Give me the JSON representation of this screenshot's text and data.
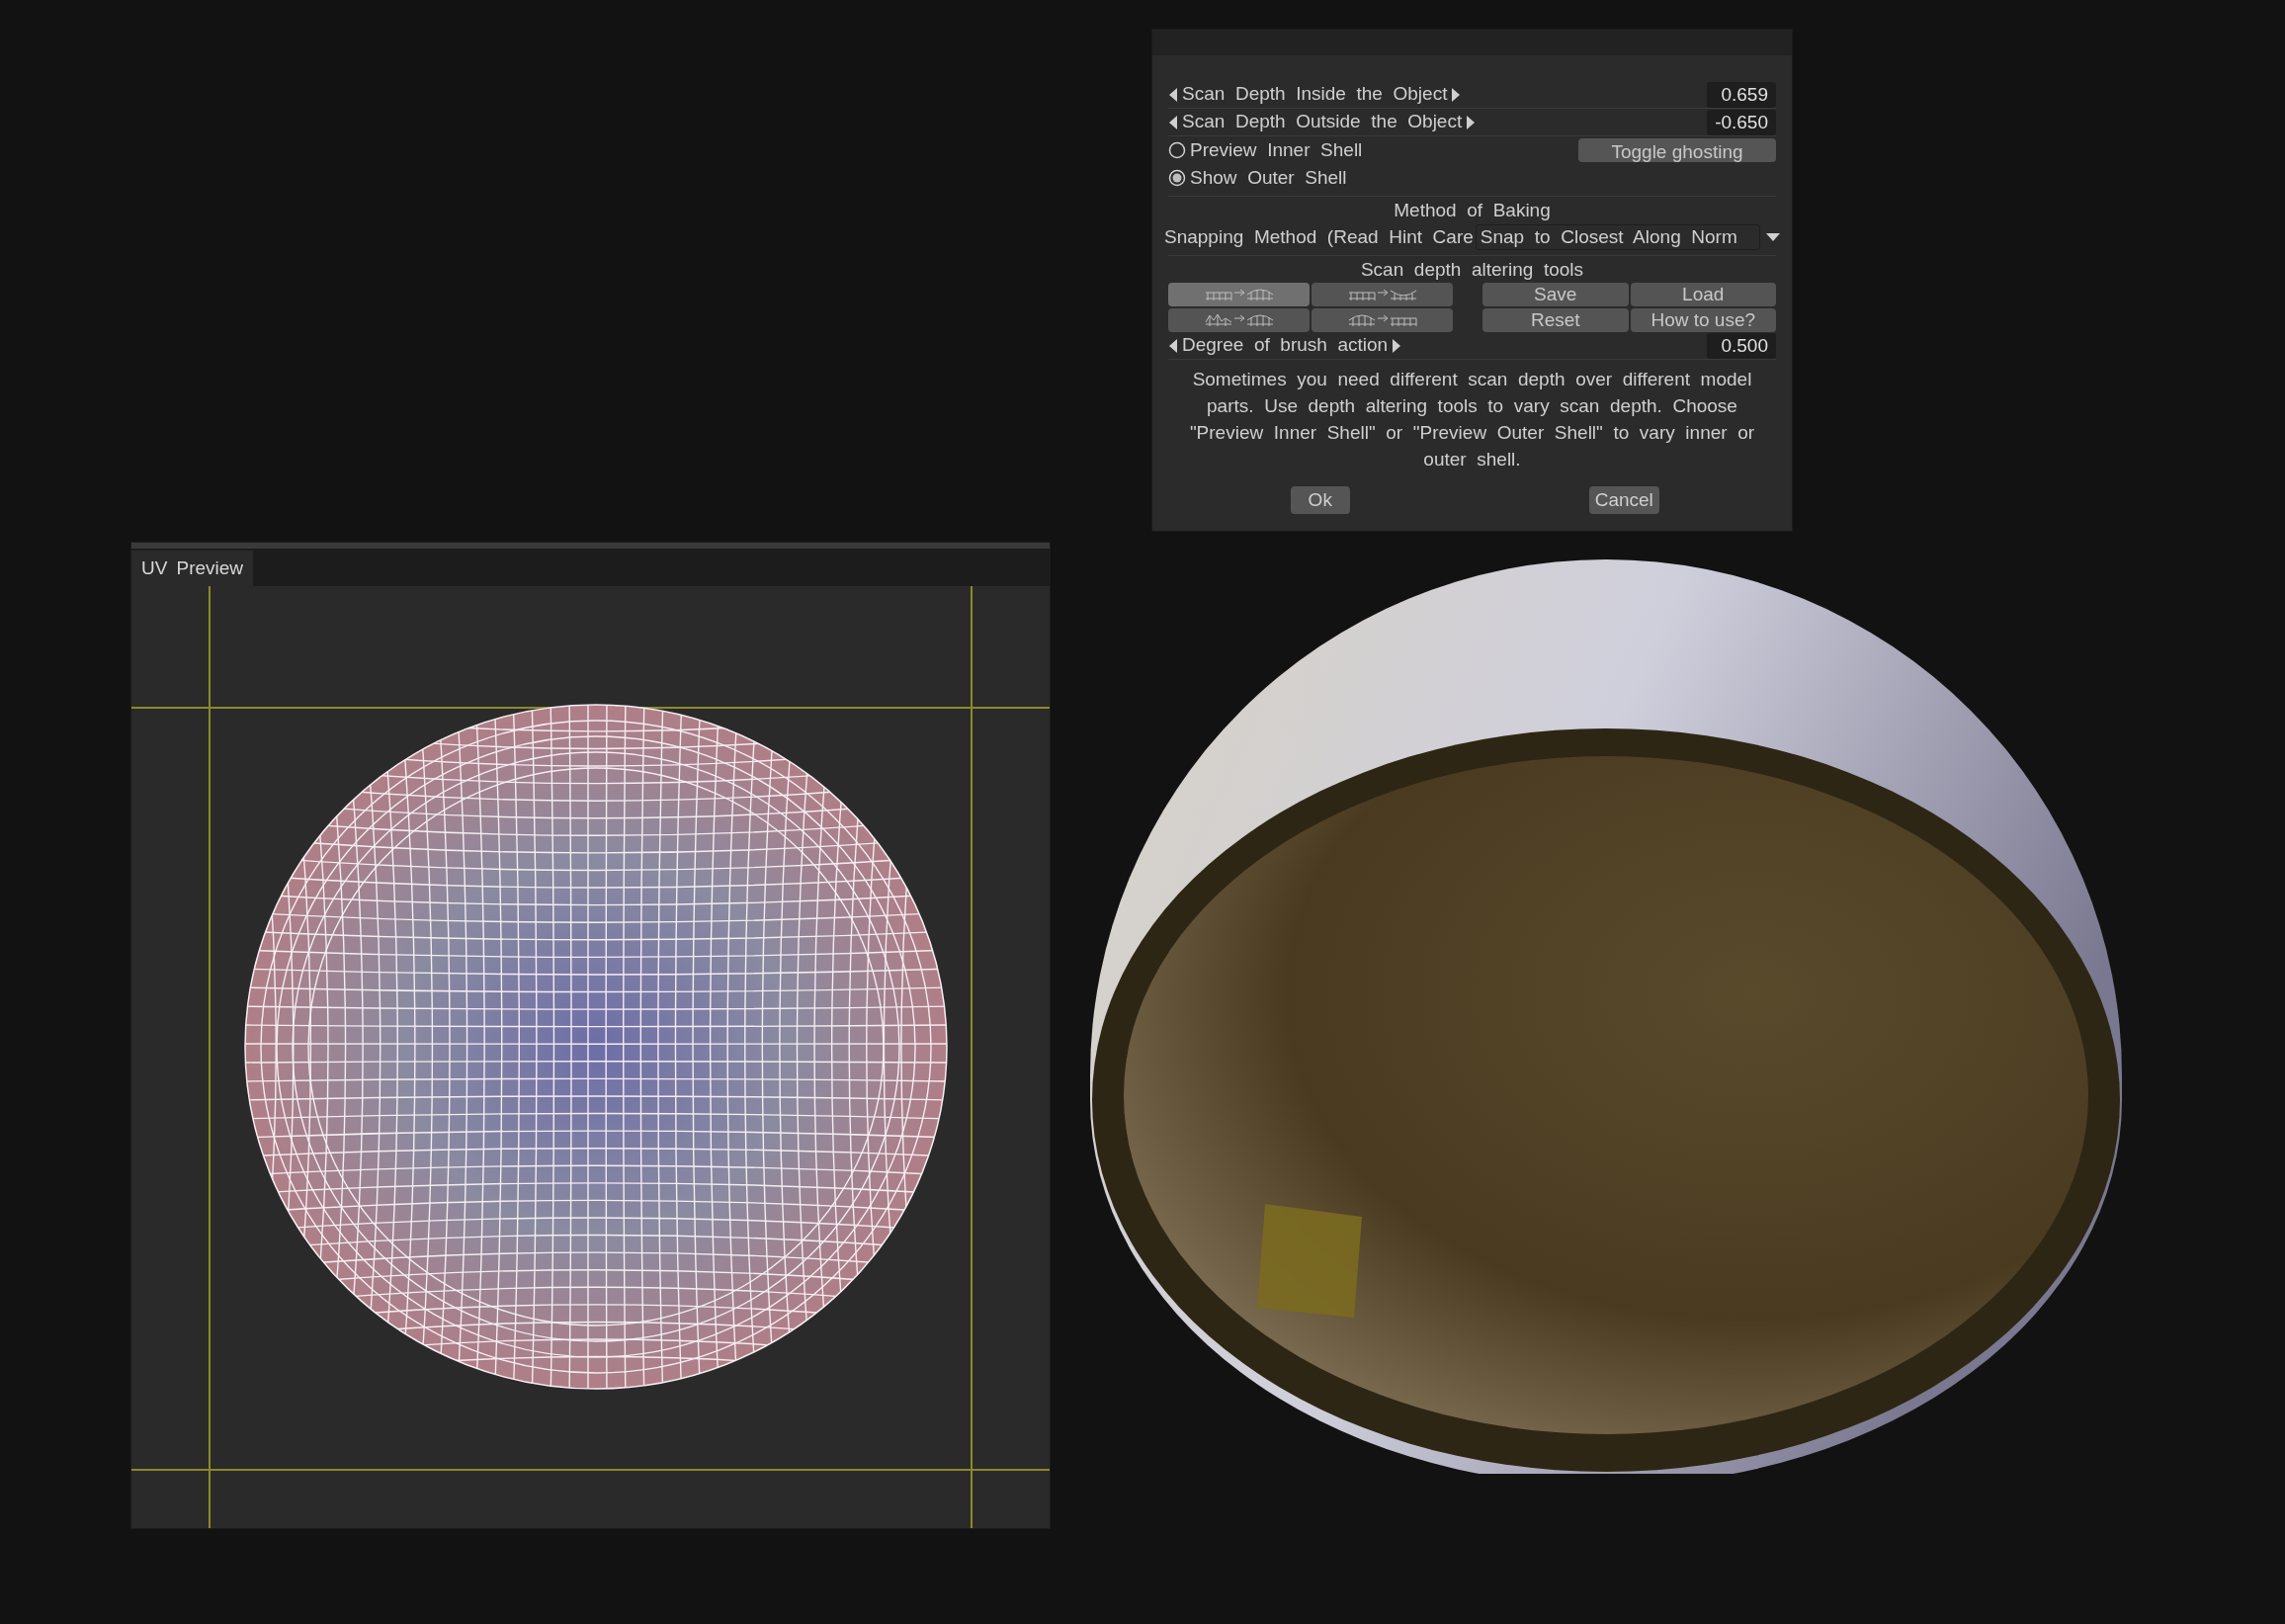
{
  "dialog": {
    "sliders": [
      {
        "label": "Scan Depth Inside the Object",
        "value": "0.659"
      },
      {
        "label": "Scan Depth Outside the Object",
        "value": "-0.650"
      }
    ],
    "shell_options": [
      {
        "label": "Preview Inner Shell",
        "selected": false
      },
      {
        "label": "Show Outer Shell",
        "selected": true
      }
    ],
    "toggle_button": "Toggle ghosting",
    "baking_heading": "Method of Baking",
    "snapping_label": "Snapping Method (Read Hint Care",
    "snapping_value": "Snap to Closest Along Norm",
    "tools_heading": "Scan depth altering tools",
    "tool_buttons": [
      {
        "kind": "flat-to-bulge",
        "selected": true
      },
      {
        "kind": "flat-to-dent",
        "selected": false
      },
      {
        "kind": "bumpy-to-bulge",
        "selected": false
      },
      {
        "kind": "bulge-to-flat",
        "selected": false
      }
    ],
    "action_buttons": [
      "Save",
      "Load",
      "Reset",
      "How to use?"
    ],
    "brush": {
      "label": "Degree of brush action",
      "value": "0.500"
    },
    "hint": "Sometimes you need different scan depth over different model parts. Use depth altering tools to vary scan depth. Choose \"Preview Inner Shell\" or \"Preview Outer Shell\" to vary inner or outer shell.",
    "ok_button": "Ok",
    "cancel_button": "Cancel"
  },
  "uv_preview": {
    "tab": "UV Preview"
  }
}
